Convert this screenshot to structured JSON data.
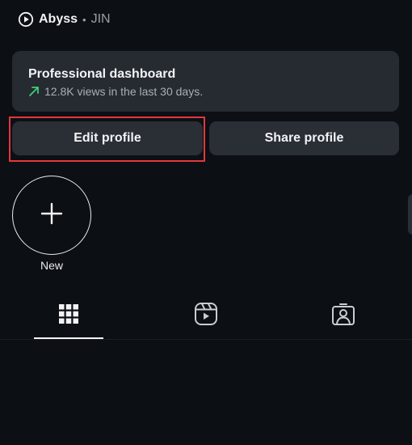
{
  "header": {
    "account_name": "Abyss",
    "separator": "•",
    "sub_name": "JIN",
    "icon": "play-circle-icon"
  },
  "dashboard": {
    "title": "Professional dashboard",
    "stats": "12.8K views in the last 30 days.",
    "trend_icon": "trend-up-arrow-icon",
    "trend_color": "#3fcf7a"
  },
  "actions": {
    "edit_label": "Edit profile",
    "share_label": "Share profile",
    "highlight_color": "#e3373d"
  },
  "highlights": {
    "new_label": "New",
    "icon": "plus-icon"
  },
  "tabs": [
    {
      "name": "grid",
      "icon": "grid-icon",
      "active": true
    },
    {
      "name": "reels",
      "icon": "reels-icon",
      "active": false
    },
    {
      "name": "tagged",
      "icon": "tagged-person-icon",
      "active": false
    }
  ]
}
